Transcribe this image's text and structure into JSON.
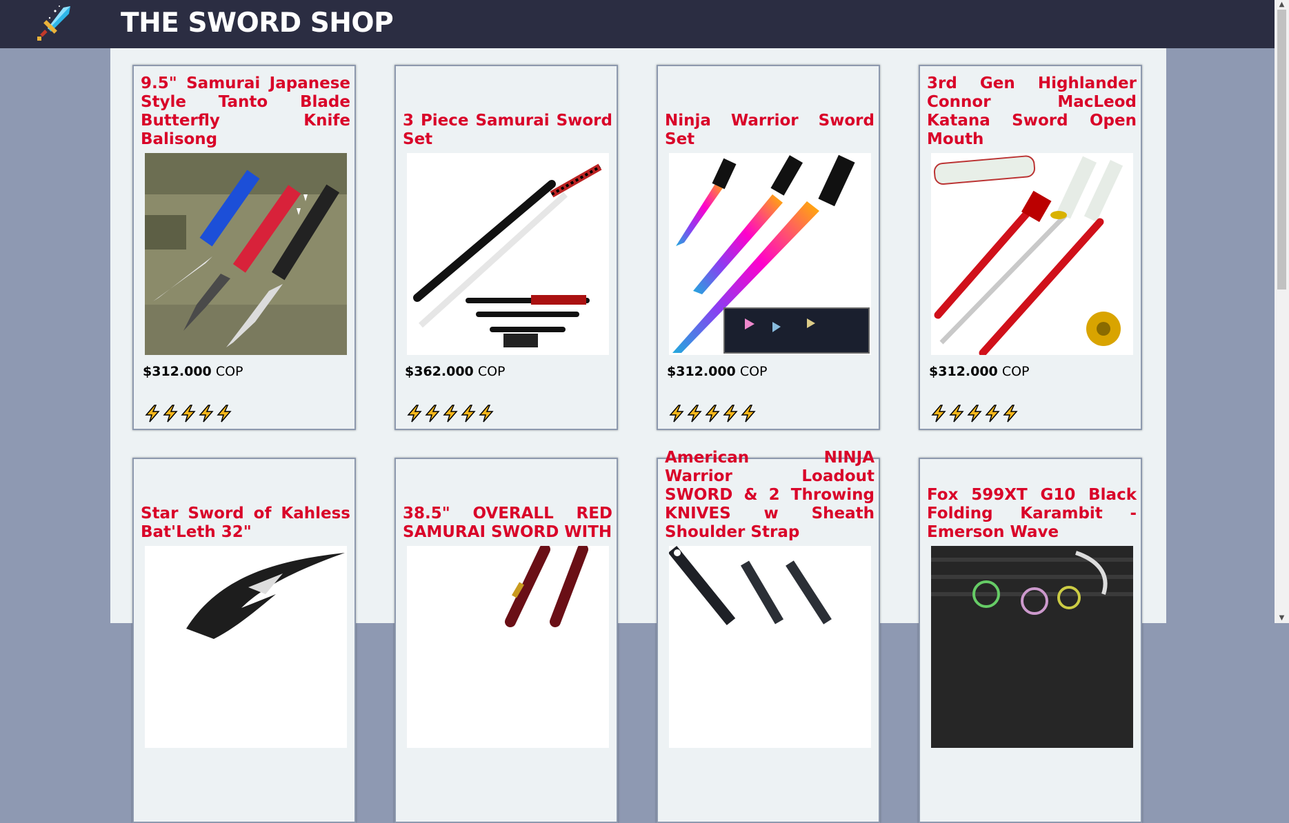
{
  "header": {
    "brand": "THE SWORD SHOP",
    "logo_icon": "sword-icon",
    "background": "#2b2d42"
  },
  "products": [
    {
      "title": "9.5\" Samurai Japanese Style Tanto Blade Butterfly Knife Balisong",
      "price": "$312.000",
      "currency": "COP",
      "rating": 5
    },
    {
      "title": "3 Piece Samurai Sword Set",
      "price": "$362.000",
      "currency": "COP",
      "rating": 5
    },
    {
      "title": "Ninja Warrior Sword Set",
      "price": "$312.000",
      "currency": "COP",
      "rating": 5
    },
    {
      "title": "3rd Gen Highlander Connor MacLeod Katana Sword Open Mouth",
      "price": "$312.000",
      "currency": "COP",
      "rating": 5
    },
    {
      "title": "Star Sword of Kahless Bat'Leth 32\""
    },
    {
      "title": "38.5\" OVERALL RED SAMURAI SWORD WITH"
    },
    {
      "title": "American NINJA Warrior Loadout SWORD & 2 Throwing KNIVES w Sheath Shoulder Strap"
    },
    {
      "title": "Fox 599XT G10 Black Folding Karambit - Emerson Wave"
    }
  ],
  "colors": {
    "title_red": "#d90429",
    "page_bg": "#8e99b2",
    "card_bg": "#edf2f4"
  }
}
